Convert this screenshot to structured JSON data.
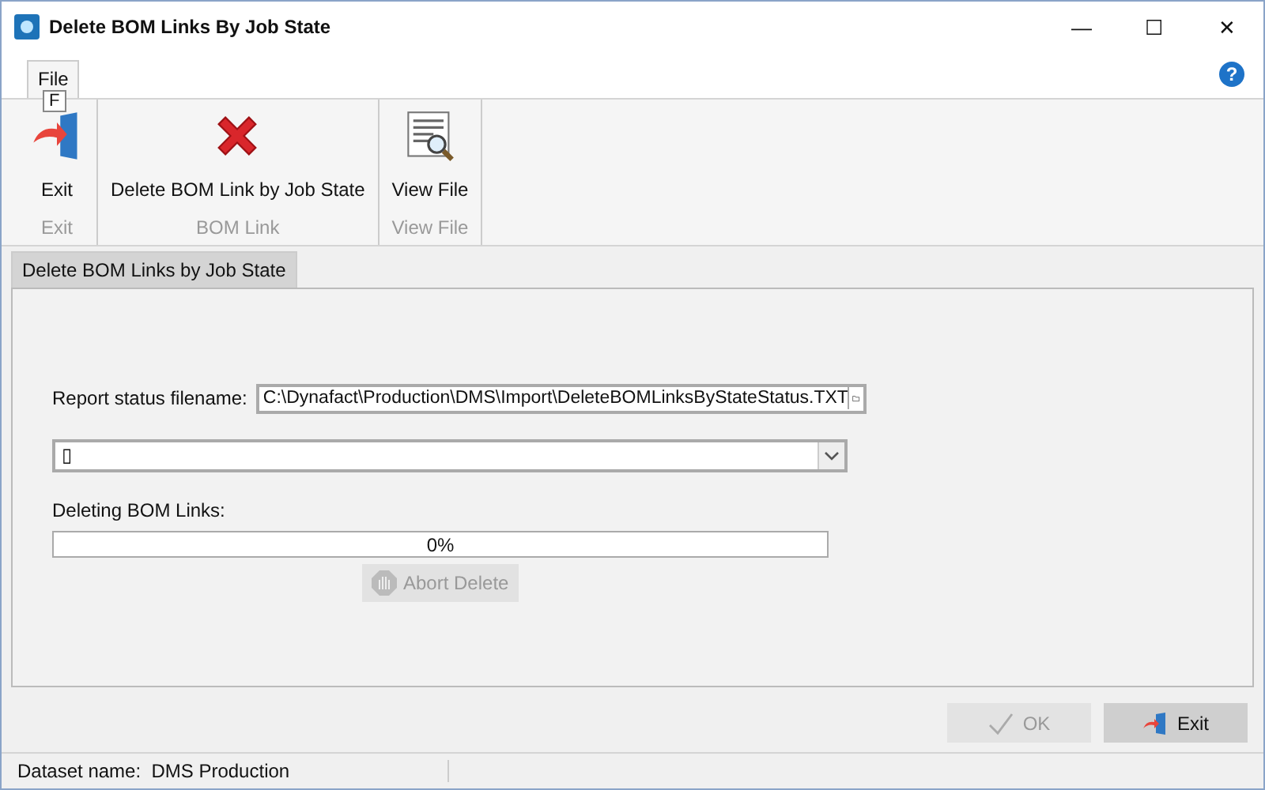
{
  "window": {
    "title": "Delete BOM Links By Job State",
    "controls": [
      "—",
      "☐",
      "✕"
    ]
  },
  "menu": {
    "tabs": [
      {
        "label": "File",
        "selected": true
      }
    ],
    "key_tip": "F",
    "help": "?"
  },
  "ribbon": {
    "groups": [
      {
        "label": "Exit",
        "buttons": [
          {
            "label": "Exit",
            "kind": "exit"
          }
        ]
      },
      {
        "label": "BOM Link",
        "buttons": [
          {
            "label": "Delete BOM Link by Job State",
            "kind": "delete"
          }
        ]
      },
      {
        "label": "View File",
        "buttons": [
          {
            "label": "View File",
            "kind": "view"
          }
        ]
      }
    ]
  },
  "page_tabs": [
    {
      "label": "Delete BOM Links by Job State",
      "selected": true
    }
  ],
  "form": {
    "filename_label": "Report status filename:",
    "filename": "C:\\Dynafact\\Production\\DMS\\Import\\DeleteBOMLinksByStateStatus.TXT",
    "dropdown_value": "▯",
    "progress_label": "Deleting BOM Links:",
    "progress_text": "0%",
    "progress": {
      "level": 0
    },
    "abort": {
      "label": "Abort Delete",
      "disabled": true
    }
  },
  "buttons": [
    {
      "label": "OK",
      "kind": "ok",
      "disabled": true
    },
    {
      "label": "Exit",
      "kind": "exit",
      "disabled": false
    }
  ],
  "status_bar": {
    "dataset_label": "Dataset name:",
    "dataset": "DMS Production"
  }
}
